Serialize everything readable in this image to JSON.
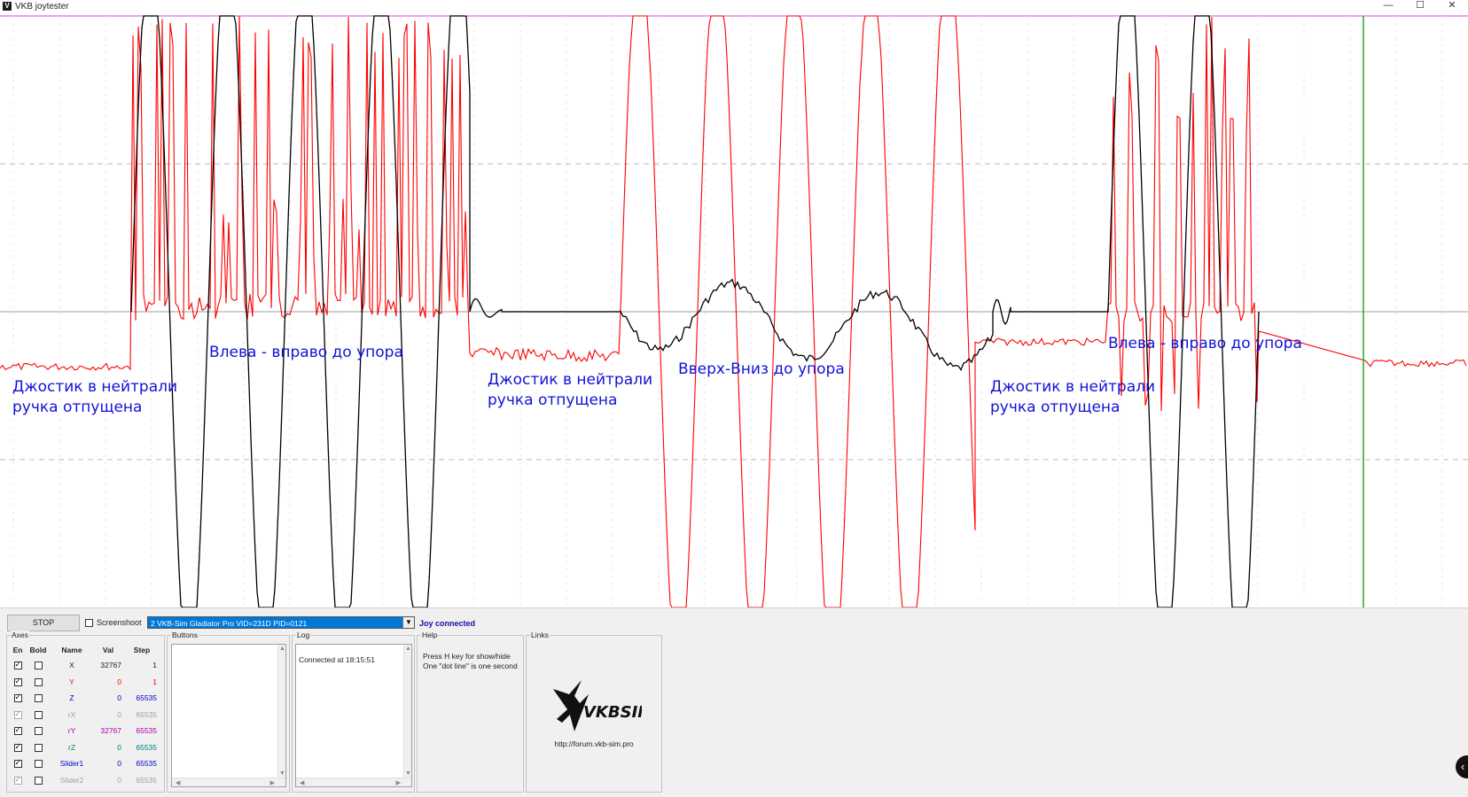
{
  "window": {
    "title": "VKB joytester",
    "icon_letter": "V",
    "minimize_glyph": "—",
    "maximize_glyph": "☐",
    "close_glyph": "✕"
  },
  "colors": {
    "red_series": "#ff0000",
    "black_series": "#000000",
    "annotation": "#1212d6",
    "cursor_line": "#22aa22",
    "top_line": "#dd44dd"
  },
  "annotations": [
    {
      "line1": "Джостик в нейтрали",
      "line2": "ручка отпущена"
    },
    {
      "line1": "Влева - вправо до упора",
      "line2": ""
    },
    {
      "line1": "Джостик в нейтрали",
      "line2": "ручка отпущена"
    },
    {
      "line1": "Вверх-Вниз до упора",
      "line2": ""
    },
    {
      "line1": "Джостик в нейтрали",
      "line2": "ручка отпущена"
    },
    {
      "line1": "Влева - вправо до упора",
      "line2": ""
    }
  ],
  "controls": {
    "stop_label": "STOP",
    "screenshot_label": "Screenshoot",
    "screenshot_checked": false,
    "device_selected": "2  VKB-Sim Gladiator Pro  VID=231D PID=0121",
    "status": "Joy connected"
  },
  "axes": {
    "title": "Axes",
    "headers": {
      "en": "En",
      "bold": "Bold",
      "name": "Name",
      "val": "Val",
      "step": "Step"
    },
    "rows": [
      {
        "en": true,
        "en_disabled": false,
        "bold": false,
        "name": "X",
        "val": "32767",
        "step": "1",
        "color": "#222222"
      },
      {
        "en": true,
        "en_disabled": false,
        "bold": false,
        "name": "Y",
        "val": "0",
        "step": "1",
        "color": "#ff0000"
      },
      {
        "en": true,
        "en_disabled": false,
        "bold": false,
        "name": "Z",
        "val": "0",
        "step": "65535",
        "color": "#0000cc"
      },
      {
        "en": true,
        "en_disabled": true,
        "bold": false,
        "name": "rX",
        "val": "0",
        "step": "65535",
        "color": "#a0a0a0"
      },
      {
        "en": true,
        "en_disabled": false,
        "bold": false,
        "name": "rY",
        "val": "32767",
        "step": "65535",
        "color": "#aa00aa"
      },
      {
        "en": true,
        "en_disabled": false,
        "bold": false,
        "name": "rZ",
        "val": "0",
        "step": "65535",
        "color": "#008080"
      },
      {
        "en": true,
        "en_disabled": false,
        "bold": false,
        "name": "Slider1",
        "val": "0",
        "step": "65535",
        "color": "#0000cc"
      },
      {
        "en": true,
        "en_disabled": true,
        "bold": false,
        "name": "Slider2",
        "val": "0",
        "step": "65535",
        "color": "#a0a0a0"
      }
    ]
  },
  "buttons_box": {
    "title": "Buttons"
  },
  "log": {
    "title": "Log",
    "entries": [
      "Connected at 18:15:51"
    ]
  },
  "help": {
    "title": "Help",
    "text": "Press H key for show/hide\nOne \"dot line\" is one second"
  },
  "links": {
    "title": "Links",
    "logo_text": "VKBSIM",
    "url": "http://forum.vkb-sim.pro"
  },
  "scroll_glyphs": {
    "up": "▲",
    "down": "▼",
    "left": "◀",
    "right": "▶"
  },
  "floating_button_glyph": "‹"
}
